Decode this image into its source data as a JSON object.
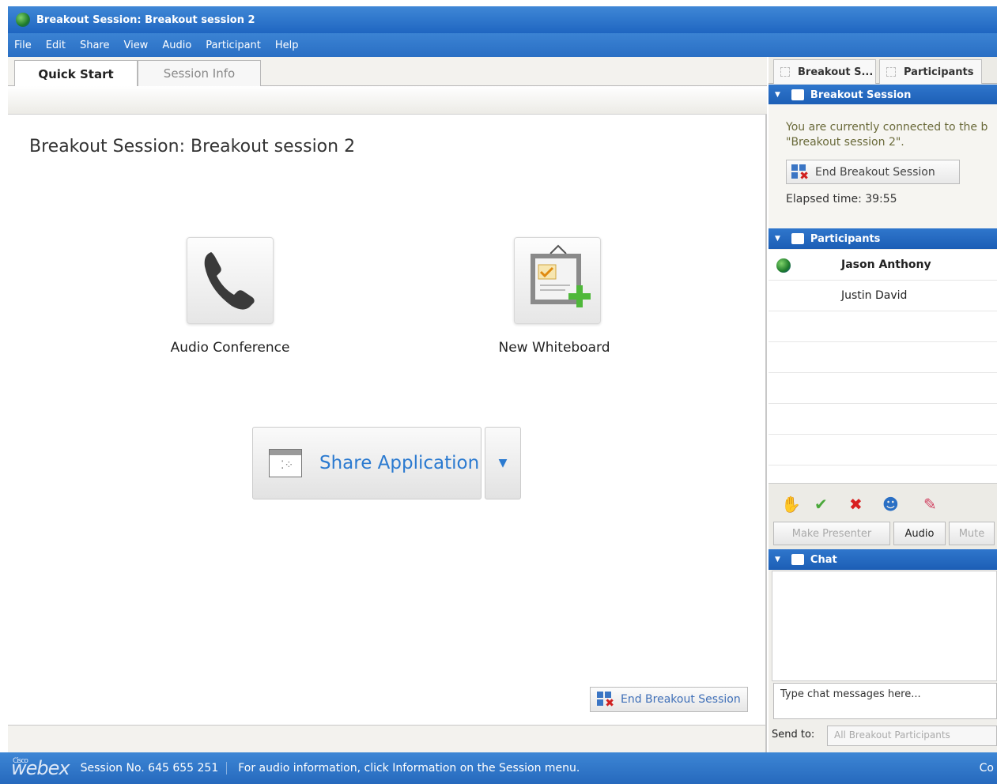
{
  "window": {
    "title": "Breakout Session: Breakout session 2"
  },
  "menu": [
    "File",
    "Edit",
    "Share",
    "View",
    "Audio",
    "Participant",
    "Help"
  ],
  "tabs": {
    "quick_start": "Quick Start",
    "session_info": "Session Info"
  },
  "main": {
    "title": "Breakout Session:  Breakout session 2",
    "audio_label": "Audio Conference",
    "whiteboard_label": "New Whiteboard",
    "share_label": "Share Application",
    "end_button": "End Breakout Session"
  },
  "right": {
    "tabs": {
      "breakout": "Breakout S...",
      "participants": "Participants"
    },
    "breakout_header": "Breakout Session",
    "connected_line1": "You are currently connected to the b",
    "connected_line2": "\"Breakout session 2\".",
    "end_button": "End Breakout Session",
    "elapsed": "Elapsed time: 39:55",
    "participants_header": "Participants",
    "participants": [
      {
        "name": "Jason Anthony"
      },
      {
        "name": "Justin David"
      }
    ],
    "buttons": {
      "make_presenter": "Make Presenter",
      "audio": "Audio",
      "mute": "Mute"
    },
    "chat_header": "Chat",
    "chat_placeholder": "Type chat messages here...",
    "send_to_label": "Send to:",
    "send_to_value": "All Breakout Participants"
  },
  "status": {
    "logo_small": "Cisco",
    "logo": "webex",
    "session_no": "Session No. 645 655 251",
    "audio_info": "For audio information, click Information on the Session menu.",
    "tail": "Co"
  },
  "colors": {
    "accent": "#2b7ad0",
    "titlebar": "#1f66c1"
  }
}
